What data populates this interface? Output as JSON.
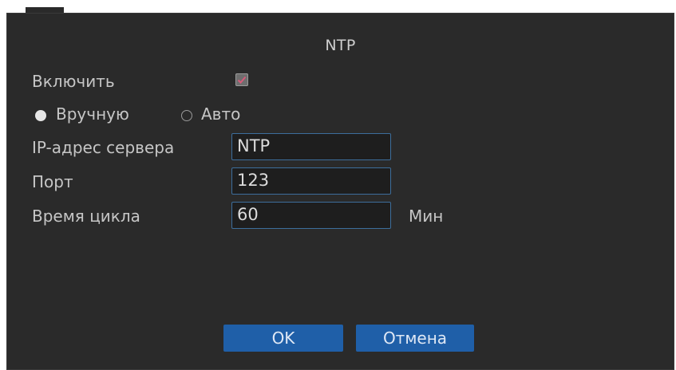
{
  "dialog": {
    "title": "NTP"
  },
  "enable": {
    "label": "Включить",
    "checked": true
  },
  "mode": {
    "manual_label": "Вручную",
    "auto_label": "Авто",
    "selected": "Вручную"
  },
  "fields": {
    "server_label": "IP-адрес сервера",
    "server_value": "NTP",
    "port_label": "Порт",
    "port_value": "123",
    "cycle_label": "Время цикла",
    "cycle_value": "60",
    "cycle_unit": "Мин"
  },
  "buttons": {
    "ok_label": "OK",
    "cancel_label": "Отмена"
  },
  "colors": {
    "window_bg": "#2a2a2a",
    "accent": "#1f5fa8",
    "field_border": "#3d6e9c"
  }
}
